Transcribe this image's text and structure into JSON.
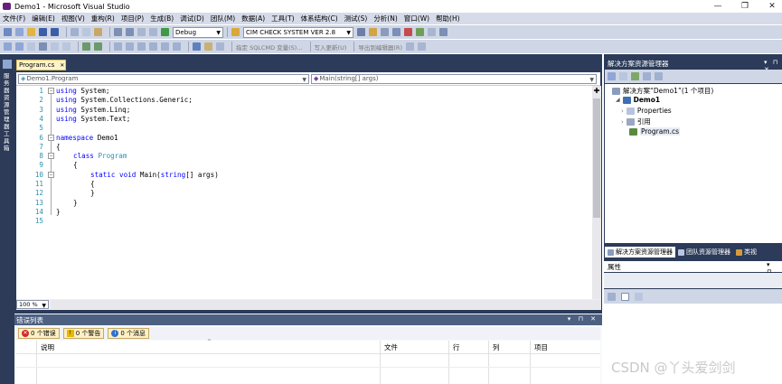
{
  "window": {
    "title": "Demo1 - Microsoft Visual Studio",
    "controls": [
      "—",
      "❐",
      "✕"
    ]
  },
  "menu": [
    "文件(F)",
    "编辑(E)",
    "视图(V)",
    "重构(R)",
    "项目(P)",
    "生成(B)",
    "调试(D)",
    "团队(M)",
    "数据(A)",
    "工具(T)",
    "体系结构(C)",
    "测试(S)",
    "分析(N)",
    "窗口(W)",
    "帮助(H)"
  ],
  "toolbar": {
    "config": "Debug",
    "project_dropdown": "CIM CHECK SYSTEM VER 2.8",
    "sql_label": "指定 SQLCMD 变量(S)...",
    "refresh_label": "写入更新(U)",
    "export_label": "导出到编辑器(R)"
  },
  "editor": {
    "tab_label": "Program.cs",
    "nav_left": "Demo1.Program",
    "nav_right": "Main(string[] args)",
    "zoom": "100 %",
    "line_numbers": [
      "1",
      "2",
      "3",
      "4",
      "5",
      "6",
      "7",
      "8",
      "9",
      "10",
      "11",
      "12",
      "13",
      "14",
      "15"
    ],
    "code": {
      "l1_kw": "using",
      "l1_rest": " System;",
      "l2_kw": "using",
      "l2_rest": " System.Collections.Generic;",
      "l3_kw": "using",
      "l3_rest": " System.Linq;",
      "l4_kw": "using",
      "l4_rest": " System.Text;",
      "l6_kw": "namespace",
      "l6_rest": " Demo1",
      "l7": "{",
      "l8_kw": "class",
      "l8_cls": "Program",
      "l9": "{",
      "l10_kw1": "static",
      "l10_kw2": "void",
      "l10_name": " Main(",
      "l10_kw3": "string",
      "l10_rest": "[] args)",
      "l11": "{",
      "l12": "}",
      "l13": "}",
      "l14": "}"
    }
  },
  "error_list": {
    "title": "错误列表",
    "errors_label": "0 个错误",
    "warnings_label": "0 个警告",
    "messages_label": "0 个消息",
    "columns": [
      "说明",
      "文件",
      "行",
      "列",
      "项目"
    ]
  },
  "solution_explorer": {
    "title": "解决方案资源管理器",
    "solution_label": "解决方案“Demo1”(1 个项目)",
    "project_label": "Demo1",
    "items": [
      "Properties",
      "引用",
      "Program.cs"
    ],
    "tabs": [
      "解决方案资源管理器",
      "团队资源管理器",
      "类视"
    ]
  },
  "properties": {
    "title": "属性"
  },
  "left_strip_text": "服务器资源管理器 工具箱",
  "watermark": "CSDN @丫头爱剑剑",
  "colors": {
    "keyword": "#0000ff",
    "type": "#2b91af",
    "panel_dark": "#2b3b59",
    "toolbar": "#cfd6e5"
  }
}
